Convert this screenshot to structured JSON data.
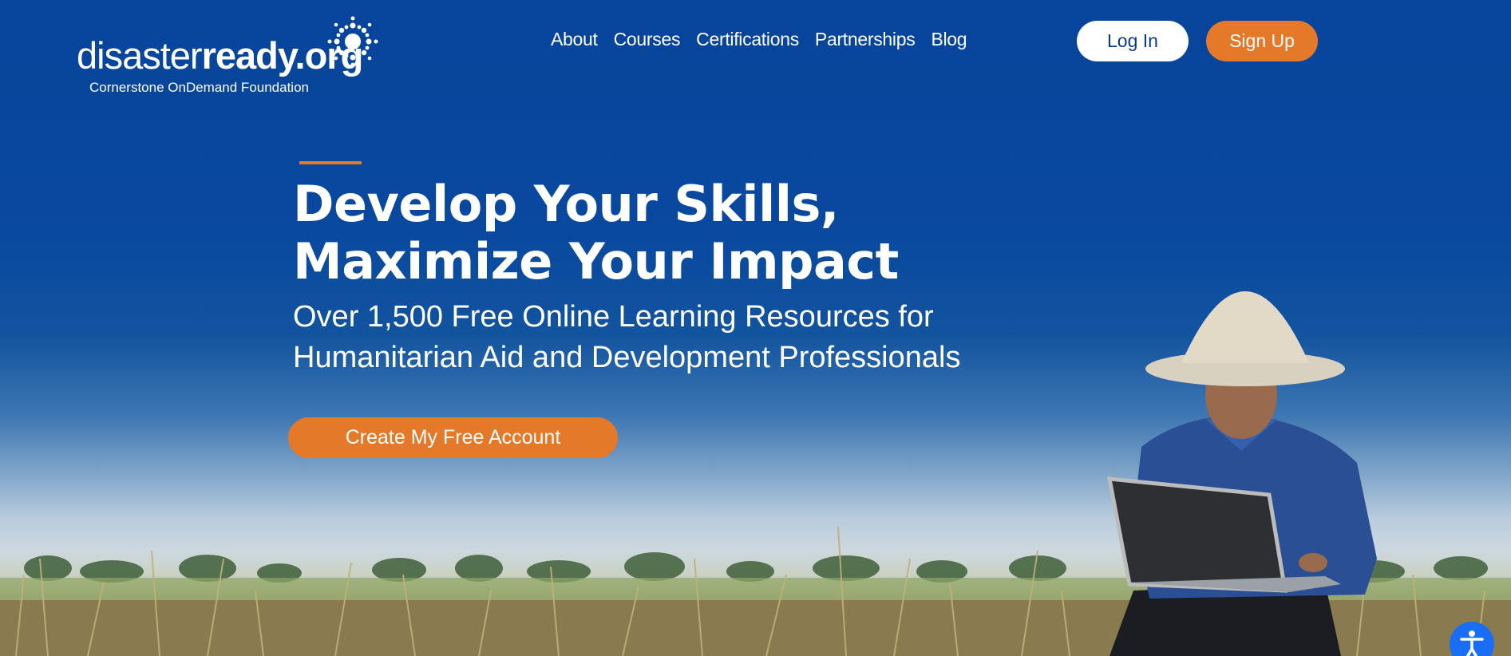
{
  "header": {
    "logo": {
      "word_light": "disaster",
      "word_bold": "ready.org",
      "tagline": "Cornerstone OnDemand Foundation"
    },
    "nav": [
      {
        "label": "About"
      },
      {
        "label": "Courses"
      },
      {
        "label": "Certifications"
      },
      {
        "label": "Partnerships"
      },
      {
        "label": "Blog"
      }
    ],
    "login_label": "Log In",
    "signup_label": "Sign Up"
  },
  "hero": {
    "title": "Develop Your Skills, Maximize Your Impact",
    "subtitle": "Over 1,500 Free Online Learning Resources for Humanitarian Aid and Development Professionals",
    "cta_label": "Create My Free Account"
  },
  "icons": {
    "logo_burst": "sunburst-icon",
    "accessibility": "accessibility-icon"
  },
  "colors": {
    "brand_blue": "#08479c",
    "accent_orange": "#e4792a",
    "white": "#ffffff",
    "accessibility_blue": "#1a6ef5"
  }
}
